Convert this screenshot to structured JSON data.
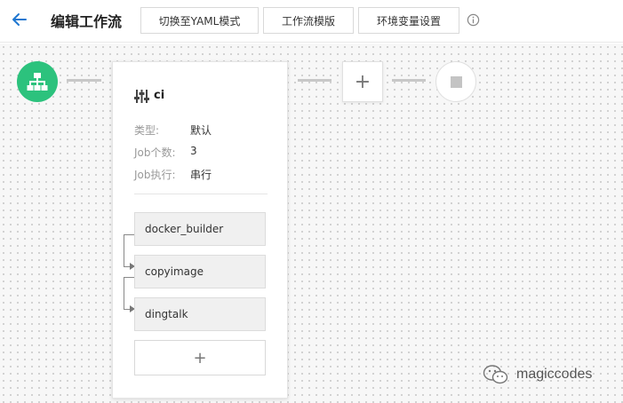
{
  "header": {
    "title": "编辑工作流",
    "buttons": {
      "yaml": "切换至YAML模式",
      "template": "工作流模版",
      "env": "环境变量设置"
    }
  },
  "stage": {
    "name": "ci",
    "props": [
      {
        "label": "类型:",
        "value": "默认"
      },
      {
        "label": "Job个数:",
        "value": "3"
      },
      {
        "label": "Job执行:",
        "value": "串行"
      }
    ],
    "jobs": [
      "docker_builder",
      "copyimage",
      "dingtalk"
    ],
    "add_job_label": "+"
  },
  "add_stage_label": "+",
  "watermark": "magiccodes",
  "colors": {
    "start": "#2cc27d",
    "back": "#1f77d0"
  }
}
